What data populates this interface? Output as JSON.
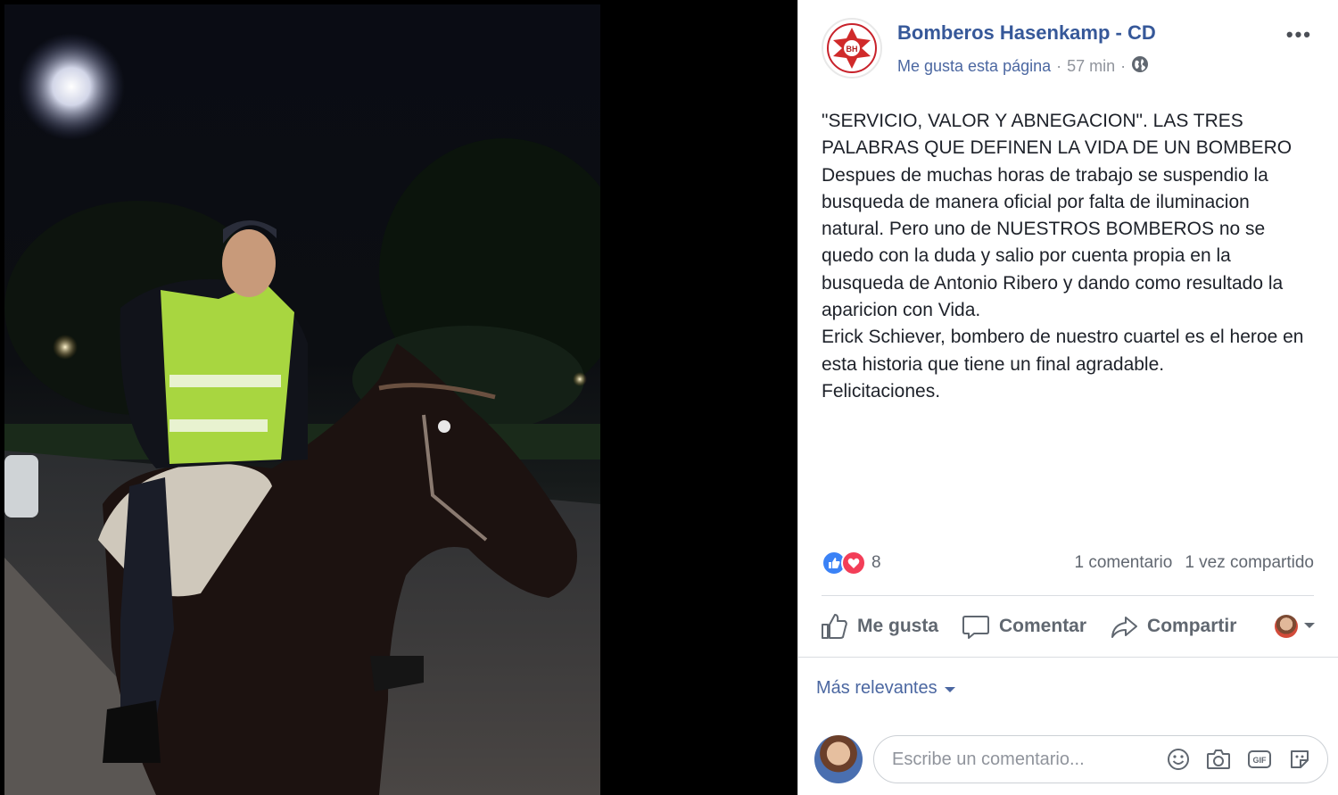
{
  "post": {
    "page_name": "Bomberos Hasenkamp - CD",
    "like_page": "Me gusta esta página",
    "separator": "·",
    "time": "57 min",
    "separator2": "·",
    "more": "•••",
    "body_lines": [
      "\"SERVICIO, VALOR Y ABNEGACION\". LAS TRES PALABRAS QUE DEFINEN LA VIDA DE UN BOMBERO",
      "Despues de muchas horas de trabajo se suspendio la busqueda de manera oficial por falta de iluminacion natural. Pero uno de NUESTROS BOMBEROS no se quedo con la duda y salio por cuenta propia en la busqueda de Antonio Ribero y dando como resultado la aparicion con Vida.",
      "Erick Schiever, bombero de nuestro cuartel es el heroe en esta historia que tiene un final agradable.",
      "Felicitaciones."
    ]
  },
  "stats": {
    "reaction_count": "8",
    "comments": "1 comentario",
    "shares": "1 vez compartido"
  },
  "actions": {
    "like": "Me gusta",
    "comment": "Comentar",
    "share": "Compartir"
  },
  "comments": {
    "sort": "Más relevantes",
    "placeholder": "Escribe un comentario..."
  },
  "icons": {
    "avatar_badge": "firefighter-badge-icon",
    "privacy": "globe-icon",
    "like": "thumbs-up-icon",
    "comment": "speech-bubble-icon",
    "share": "share-arrow-icon",
    "emoji": "smiley-icon",
    "camera": "camera-icon",
    "gif": "gif-icon",
    "sticker": "sticker-icon"
  },
  "colors": {
    "link": "#365899",
    "like_blue": "#3b82f6",
    "love_red": "#f33e58"
  }
}
